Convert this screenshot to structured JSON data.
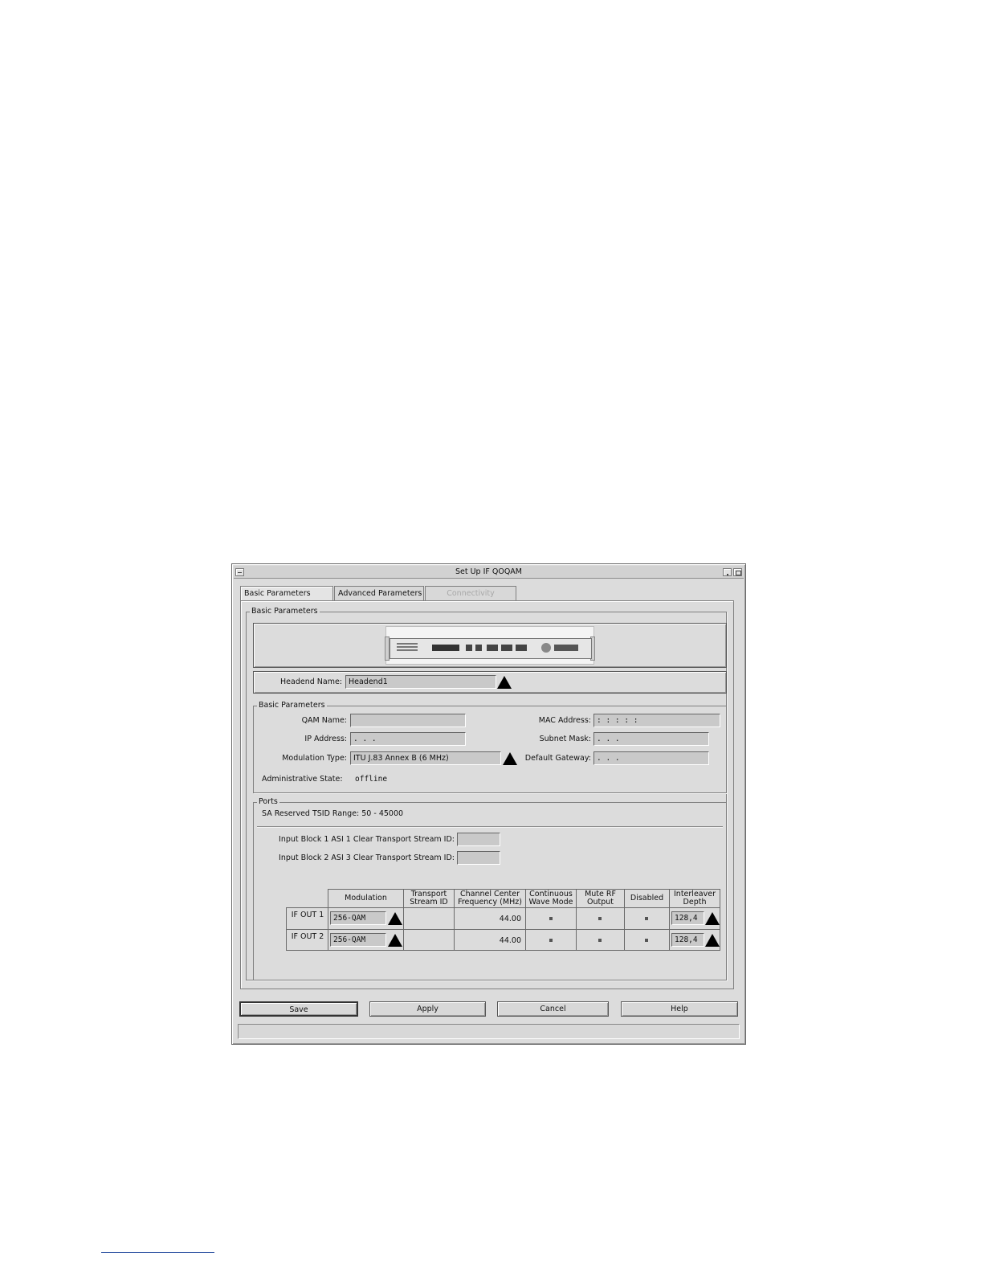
{
  "window": {
    "title": "Set Up IF QOQAM"
  },
  "tabs": [
    {
      "label": "Basic Parameters"
    },
    {
      "label": "Advanced Parameters"
    },
    {
      "label": "Connectivity"
    }
  ],
  "main_group": {
    "legend": "Basic Parameters"
  },
  "headend": {
    "label": "Headend Name:",
    "value": "Headend1"
  },
  "basic": {
    "legend": "Basic Parameters",
    "qam_name_label": "QAM Name:",
    "qam_name_value": "",
    "ip_label": "IP Address:",
    "ip_value": ". . .",
    "modulation_type_label": "Modulation Type:",
    "modulation_type_value": "ITU J.83 Annex B (6 MHz)",
    "admin_state_label": "Administrative State:",
    "admin_state_value": "offline",
    "mac_label": "MAC Address:",
    "mac_value": ": : : : :",
    "subnet_label": "Subnet Mask:",
    "subnet_value": ". . .",
    "gateway_label": "Default Gateway:",
    "gateway_value": ". . ."
  },
  "ports": {
    "legend": "Ports",
    "tsid_range": "SA Reserved TSID Range: 50 - 45000",
    "block1_label": "Input Block 1 ASI 1 Clear Transport Stream ID:",
    "block1_value": "",
    "block2_label": "Input Block 2 ASI 3 Clear Transport Stream ID:",
    "block2_value": "",
    "table": {
      "headers": {
        "modulation": "Modulation",
        "tsid": "Transport Stream ID",
        "freq": "Channel Center Frequency (MHz)",
        "cw": "Continuous Wave Mode",
        "mute": "Mute RF Output",
        "disabled": "Disabled",
        "interleaver": "Interleaver Depth"
      },
      "rows": [
        {
          "label": "IF OUT 1",
          "modulation": "256-QAM",
          "tsid": "",
          "freq": "44.00",
          "interleaver": "128,4"
        },
        {
          "label": "IF OUT 2",
          "modulation": "256-QAM",
          "tsid": "",
          "freq": "44.00",
          "interleaver": "128,4"
        }
      ]
    }
  },
  "buttons": {
    "save": "Save",
    "apply": "Apply",
    "cancel": "Cancel",
    "help": "Help"
  },
  "status_bar": {
    "text": ""
  },
  "icons": {
    "dropdown_arrow": "triangle-up-icon",
    "window_menu": "window-menu-icon",
    "minimize": "minimize-icon",
    "maximize": "maximize-icon",
    "device": "qam-device-image"
  }
}
